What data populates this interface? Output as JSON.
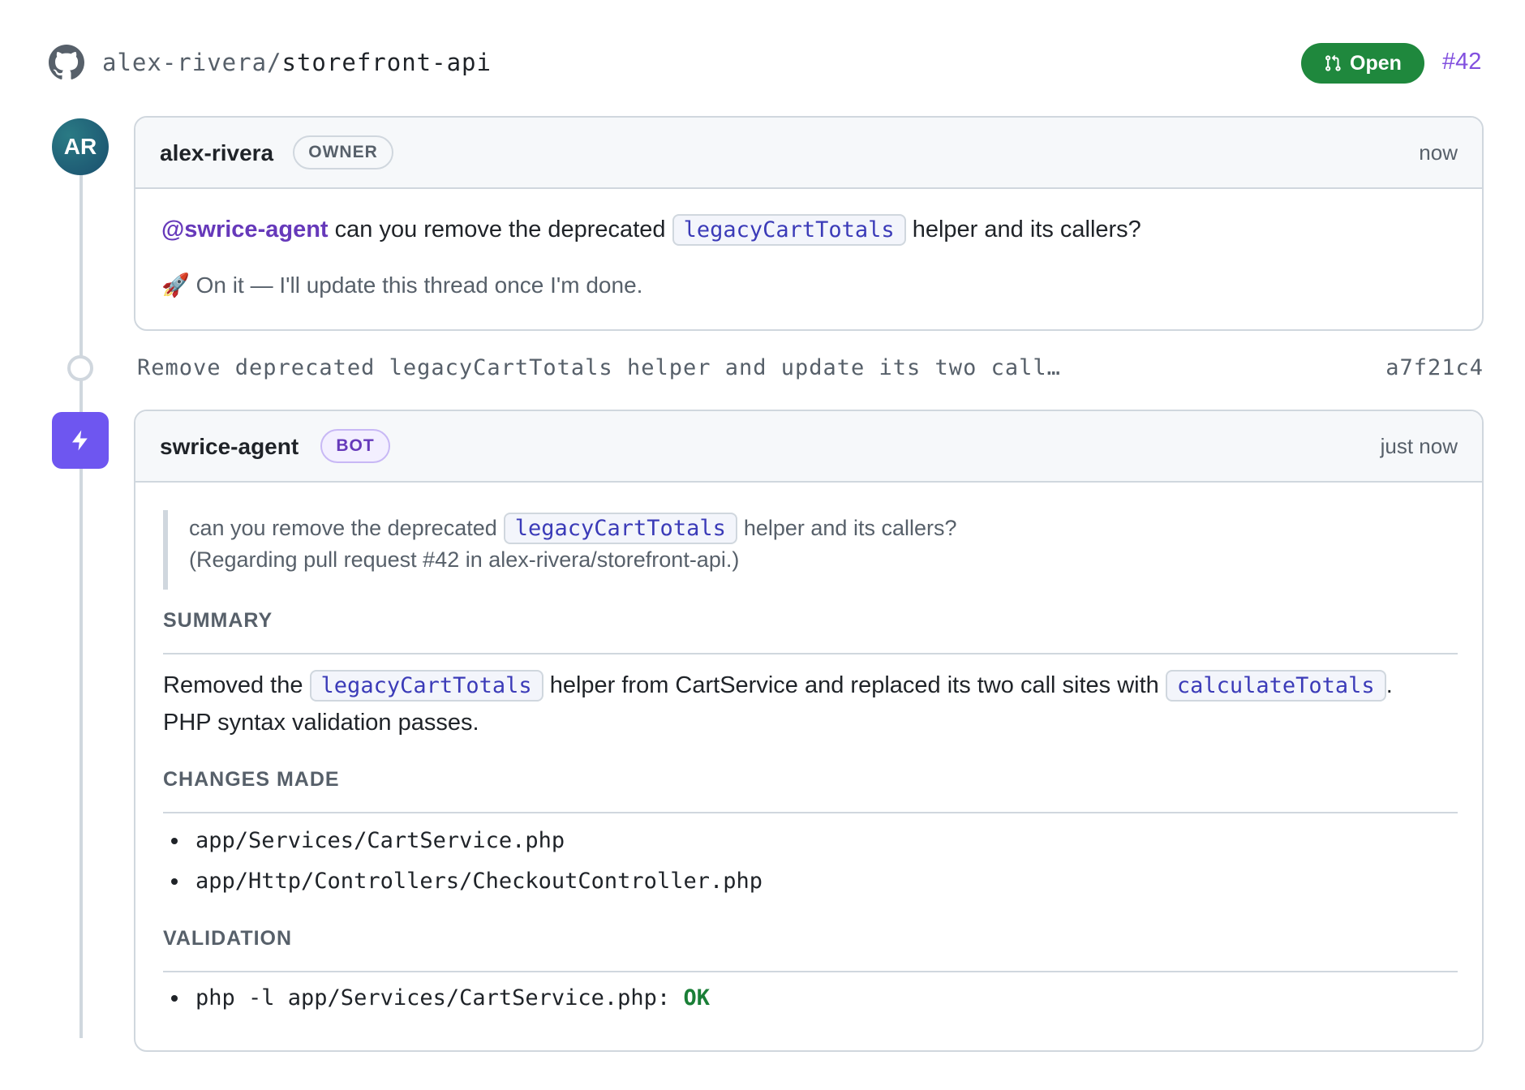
{
  "header": {
    "repo_owner": "alex-rivera/",
    "repo_name": "storefront-api",
    "state_label": "Open",
    "pr_number": "#42"
  },
  "comment1": {
    "avatar_initials": "AR",
    "author": "alex-rivera",
    "role": "OWNER",
    "time": "now",
    "mention": "@swrice-agent",
    "text_before_code": " can you remove the deprecated ",
    "code": "legacyCartTotals",
    "text_after_code": " helper and its callers?",
    "reply_emoji": "🚀",
    "reply_text": "On it — I'll update this thread once I'm done."
  },
  "commit": {
    "message": "Remove deprecated legacyCartTotals helper and update its two call…",
    "sha": "a7f21c4"
  },
  "comment2": {
    "author": "swrice-agent",
    "role": "BOT",
    "time": "just now",
    "quote_before": "can you remove the deprecated ",
    "quote_code": "legacyCartTotals",
    "quote_after": " helper and its callers?",
    "quote_line2": "(Regarding pull request #42 in alex-rivera/storefront-api.)",
    "summary_heading": "SUMMARY",
    "summary_t1": "Removed the ",
    "summary_code1": "legacyCartTotals",
    "summary_t2": " helper from CartService and replaced its two call sites with ",
    "summary_code2": "calculateTotals",
    "summary_t3": ".",
    "summary_line2": "PHP syntax validation passes.",
    "changes_heading": "CHANGES MADE",
    "changes": [
      "app/Services/CartService.php",
      "app/Http/Controllers/CheckoutController.php"
    ],
    "validation_heading": "VALIDATION",
    "validation_cmd": "php -l app/Services/CartService.php:",
    "validation_result": "OK"
  },
  "colors": {
    "open_green": "#1f883d",
    "bot_purple": "#6e56f0",
    "ok_green": "#1a7f37"
  }
}
